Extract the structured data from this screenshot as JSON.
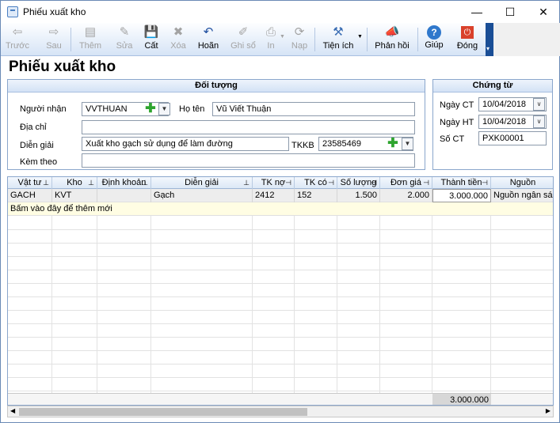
{
  "window": {
    "title": "Phiếu xuất kho",
    "minimize": "—",
    "maximize": "☐",
    "close": "✕"
  },
  "toolbar": {
    "buttons": [
      {
        "label": "Trước",
        "icon": "⇦",
        "enabled": false
      },
      {
        "label": "Sau",
        "icon": "⇨",
        "enabled": false
      },
      {
        "label": "Thêm",
        "icon": "▤",
        "enabled": false
      },
      {
        "label": "Sửa",
        "icon": "✎",
        "enabled": false
      },
      {
        "label": "Cất",
        "icon": "💾",
        "enabled": true
      },
      {
        "label": "Xóa",
        "icon": "✖",
        "enabled": false
      },
      {
        "label": "Hoãn",
        "icon": "↶",
        "enabled": true
      },
      {
        "label": "Ghi sổ",
        "icon": "✐",
        "enabled": false
      },
      {
        "label": "In",
        "icon": "⎙",
        "enabled": false
      },
      {
        "label": "Nạp",
        "icon": "⟳",
        "enabled": false
      },
      {
        "label": "Tiện ích",
        "icon": "⚒",
        "enabled": true
      },
      {
        "label": "Phản hồi",
        "icon": "📣",
        "enabled": true
      },
      {
        "label": "Giúp",
        "icon": "?",
        "enabled": true
      },
      {
        "label": "Đóng",
        "icon": "⏻",
        "enabled": true
      }
    ]
  },
  "heading": "Phiếu xuất kho",
  "doi_tuong": {
    "title": "Đối tượng",
    "nguoi_nhan_label": "Người nhận",
    "nguoi_nhan_value": "VVTHUAN",
    "ho_ten_label": "Họ tên",
    "ho_ten_value": "Vũ Viết Thuận",
    "dia_chi_label": "Địa chỉ",
    "dia_chi_value": "",
    "dien_giai_label": "Diễn giải",
    "dien_giai_value": "Xuất kho gạch sử dụng để làm đường",
    "tkkb_label": "TKKB",
    "tkkb_value": "23585469",
    "kem_theo_label": "Kèm theo",
    "kem_theo_value": ""
  },
  "chung_tu": {
    "title": "Chứng từ",
    "ngay_ct_label": "Ngày CT",
    "ngay_ct_value": "10/04/2018",
    "ngay_ht_label": "Ngày HT",
    "ngay_ht_value": "10/04/2018",
    "so_ct_label": "Số CT",
    "so_ct_value": "PXK00001"
  },
  "grid": {
    "columns": [
      "Vật tư",
      "Kho",
      "Định khoản",
      "Diễn giải",
      "TK nợ",
      "TK có",
      "Số lượng",
      "Đơn giá",
      "Thành tiền",
      "Nguồn"
    ],
    "rows": [
      [
        "GACH",
        "KVT",
        "",
        "Gạch",
        "2412",
        "152",
        "1.500",
        "2.000",
        "3.000.000",
        "Nguồn ngân sác..."
      ]
    ],
    "add_new_text": "Bấm vào đây để thêm mới",
    "total": "3.000.000"
  }
}
